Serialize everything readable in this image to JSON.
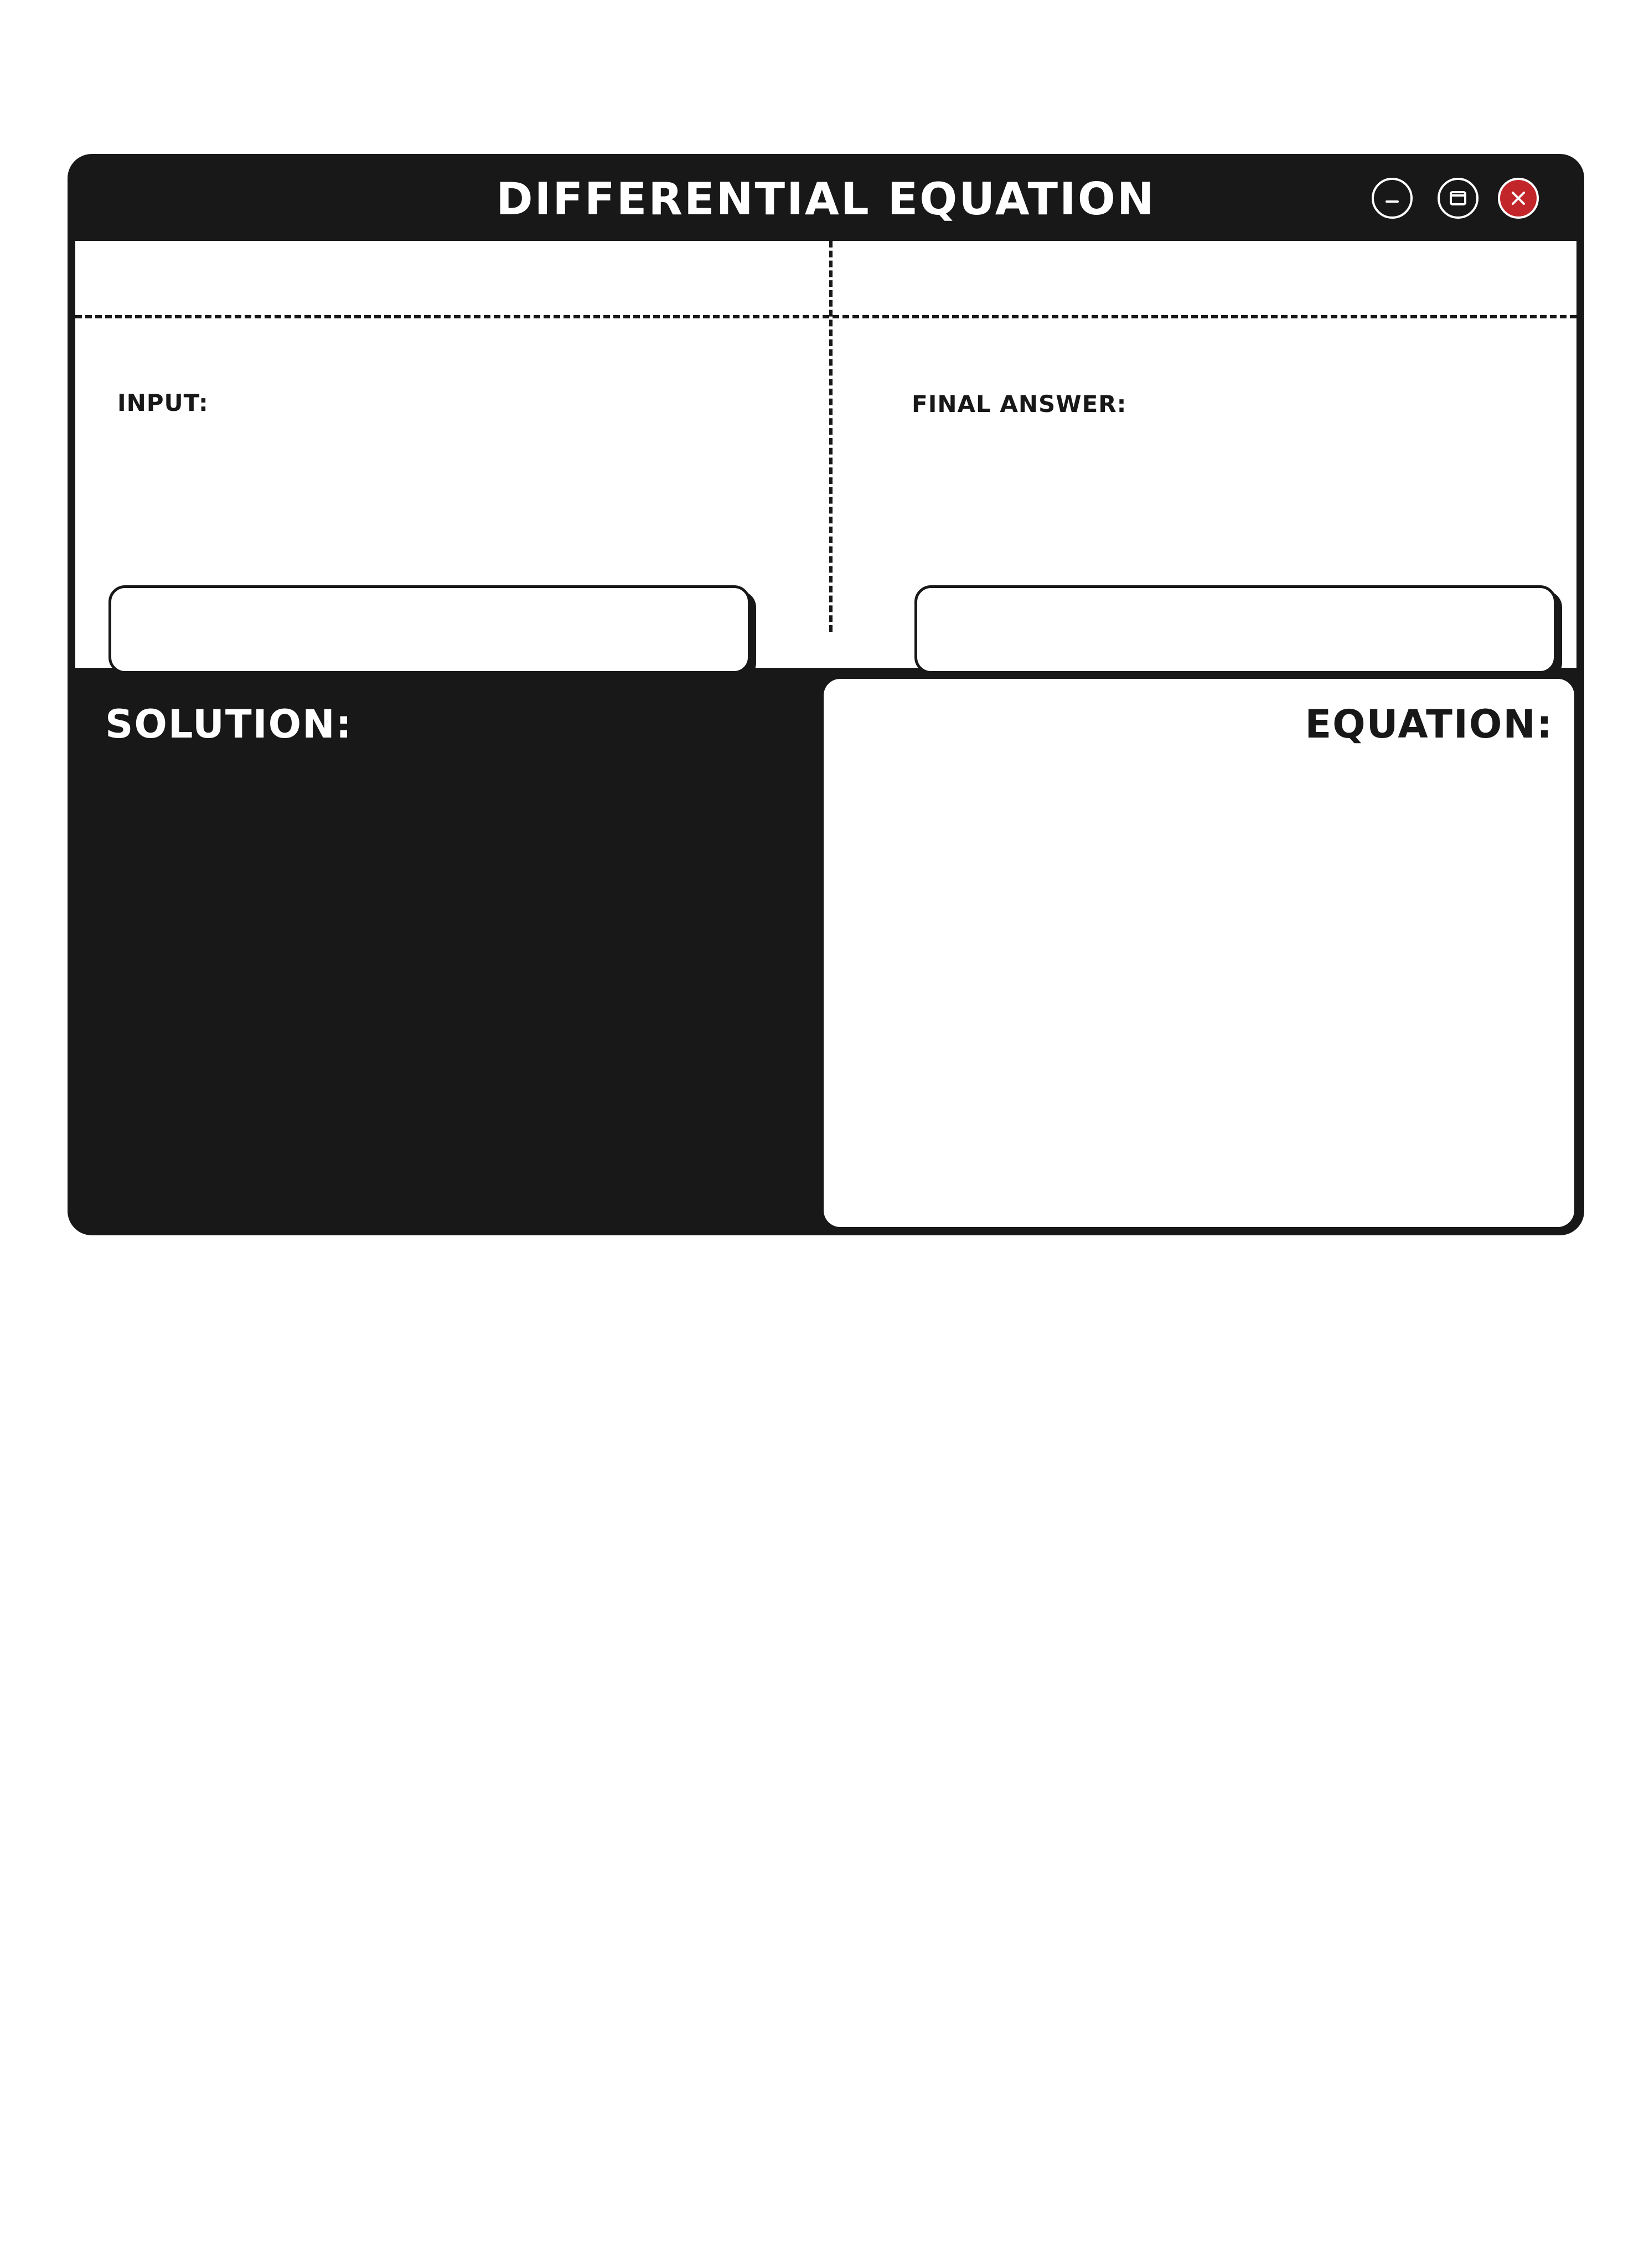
{
  "window": {
    "title": "DIFFERENTIAL EQUATION",
    "controls": {
      "minimize_icon": "minimize-icon",
      "maximize_icon": "maximize-icon",
      "close_icon": "close-icon",
      "close_color": "#c2262a"
    }
  },
  "form": {
    "input_label": "INPUT:",
    "input_value": "",
    "final_answer_label": "FINAL ANSWER:",
    "final_answer_value": ""
  },
  "panels": {
    "solution_title": "SOLUTION:",
    "equation_title": "EQUATION:"
  },
  "colors": {
    "frame": "#181818",
    "background": "#ffffff",
    "close_button": "#c2262a"
  }
}
